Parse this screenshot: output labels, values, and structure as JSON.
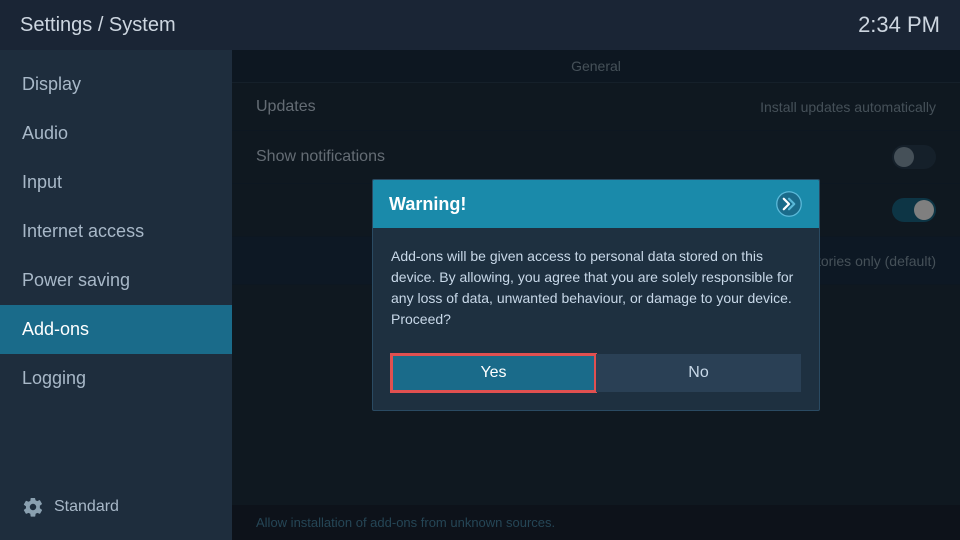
{
  "header": {
    "title": "Settings / System",
    "time": "2:34 PM"
  },
  "sidebar": {
    "items": [
      {
        "id": "display",
        "label": "Display",
        "active": false
      },
      {
        "id": "audio",
        "label": "Audio",
        "active": false
      },
      {
        "id": "input",
        "label": "Input",
        "active": false
      },
      {
        "id": "internet-access",
        "label": "Internet access",
        "active": false
      },
      {
        "id": "power-saving",
        "label": "Power saving",
        "active": false
      },
      {
        "id": "add-ons",
        "label": "Add-ons",
        "active": true
      },
      {
        "id": "logging",
        "label": "Logging",
        "active": false
      }
    ],
    "bottom_label": "Standard"
  },
  "content": {
    "tab_label": "General",
    "rows": [
      {
        "id": "updates",
        "label": "Updates",
        "value": "Install updates automatically",
        "control": "text"
      },
      {
        "id": "show-notifications",
        "label": "Show notifications",
        "value": "",
        "control": "toggle-off"
      },
      {
        "id": "unknown-sources",
        "label": "",
        "value": "",
        "control": "toggle-on"
      },
      {
        "id": "repo",
        "label": "",
        "value": "Official repositories only (default)",
        "control": "none"
      }
    ],
    "hint": "Allow installation of add-ons from unknown sources."
  },
  "dialog": {
    "title": "Warning!",
    "body": "Add-ons will be given access to personal data stored on this device. By allowing, you agree that you are solely responsible for any loss of data, unwanted behaviour, or damage to your device. Proceed?",
    "yes_label": "Yes",
    "no_label": "No"
  }
}
